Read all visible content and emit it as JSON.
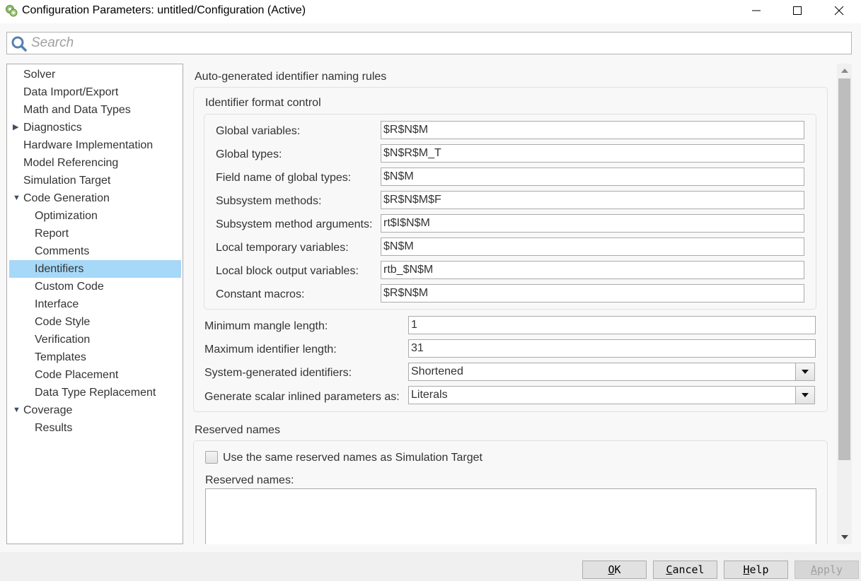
{
  "window": {
    "title": "Configuration Parameters: untitled/Configuration (Active)",
    "app_icon": "simulink-config-gear-icon",
    "controls": [
      "minimize",
      "maximize",
      "close"
    ]
  },
  "search": {
    "placeholder": "Search",
    "value": ""
  },
  "tree": {
    "selected": "Identifiers",
    "selection_color": "#a6d8f8",
    "items": [
      {
        "label": "Solver",
        "level": 0,
        "expander": null
      },
      {
        "label": "Data Import/Export",
        "level": 0,
        "expander": null
      },
      {
        "label": "Math and Data Types",
        "level": 0,
        "expander": null
      },
      {
        "label": "Diagnostics",
        "level": 0,
        "expander": "collapsed"
      },
      {
        "label": "Hardware Implementation",
        "level": 0,
        "expander": null
      },
      {
        "label": "Model Referencing",
        "level": 0,
        "expander": null
      },
      {
        "label": "Simulation Target",
        "level": 0,
        "expander": null
      },
      {
        "label": "Code Generation",
        "level": 0,
        "expander": "expanded"
      },
      {
        "label": "Optimization",
        "level": 1,
        "expander": null
      },
      {
        "label": "Report",
        "level": 1,
        "expander": null
      },
      {
        "label": "Comments",
        "level": 1,
        "expander": null
      },
      {
        "label": "Identifiers",
        "level": 1,
        "expander": null,
        "selected": true
      },
      {
        "label": "Custom Code",
        "level": 1,
        "expander": null
      },
      {
        "label": "Interface",
        "level": 1,
        "expander": null
      },
      {
        "label": "Code Style",
        "level": 1,
        "expander": null
      },
      {
        "label": "Verification",
        "level": 1,
        "expander": null
      },
      {
        "label": "Templates",
        "level": 1,
        "expander": null
      },
      {
        "label": "Code Placement",
        "level": 1,
        "expander": null
      },
      {
        "label": "Data Type Replacement",
        "level": 1,
        "expander": null
      },
      {
        "label": "Coverage",
        "level": 0,
        "expander": "expanded"
      },
      {
        "label": "Results",
        "level": 1,
        "expander": null
      }
    ]
  },
  "naming_rules": {
    "title": "Auto-generated identifier naming rules",
    "format_control": {
      "title": "Identifier format control",
      "fields": [
        {
          "label": "Global variables:",
          "value": "$R$N$M"
        },
        {
          "label": "Global types:",
          "value": "$N$R$M_T"
        },
        {
          "label": "Field name of global types:",
          "value": "$N$M"
        },
        {
          "label": "Subsystem methods:",
          "value": "$R$N$M$F"
        },
        {
          "label": "Subsystem method arguments:",
          "value": "rt$I$N$M"
        },
        {
          "label": "Local temporary variables:",
          "value": "$N$M"
        },
        {
          "label": "Local block output variables:",
          "value": "rtb_$N$M"
        },
        {
          "label": "Constant macros:",
          "value": "$R$N$M"
        }
      ]
    },
    "min_mangle": {
      "label": "Minimum mangle length:",
      "value": "1"
    },
    "max_identifier": {
      "label": "Maximum identifier length:",
      "value": "31"
    },
    "system_generated": {
      "label": "System-generated identifiers:",
      "value": "Shortened"
    },
    "scalar_inlined": {
      "label": "Generate scalar inlined parameters as:",
      "value": "Literals"
    }
  },
  "reserved": {
    "title": "Reserved names",
    "checkbox_label": "Use the same reserved names as Simulation Target",
    "checkbox_checked": false,
    "names_label": "Reserved names:",
    "names_value": ""
  },
  "buttons": {
    "ok": {
      "mnemonic": "O",
      "rest": "K",
      "enabled": true
    },
    "cancel": {
      "mnemonic": "C",
      "rest": "ancel",
      "enabled": true
    },
    "help": {
      "mnemonic": "H",
      "rest": "elp",
      "enabled": true
    },
    "apply": {
      "mnemonic": "A",
      "rest": "pply",
      "enabled": false
    }
  }
}
